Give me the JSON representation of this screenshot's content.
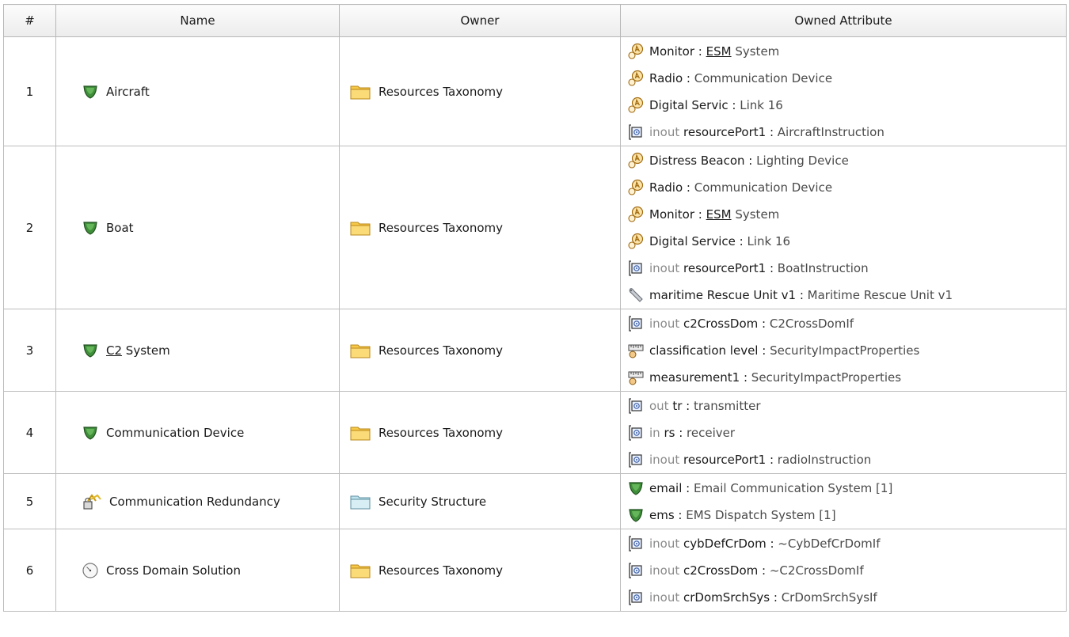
{
  "columns": {
    "num": "#",
    "name": "Name",
    "owner": "Owner",
    "owned_attribute": "Owned Attribute"
  },
  "rows": [
    {
      "num": "1",
      "name_parts": [
        {
          "t": "Aircraft"
        }
      ],
      "name_icon": "shield-block-icon",
      "owner": "Resources Taxonomy",
      "owner_icon": "package-folder-icon",
      "attrs": [
        {
          "icon": "resource-role-icon",
          "dir": "",
          "name": "Monitor",
          "type_ul": "ESM",
          "type": " System"
        },
        {
          "icon": "resource-role-icon",
          "dir": "",
          "name": "Radio",
          "type_ul": "",
          "type": "Communication Device"
        },
        {
          "icon": "resource-role-icon",
          "dir": "",
          "name": "Digital Servic",
          "type_ul": "",
          "type": "Link 16"
        },
        {
          "icon": "port-icon",
          "dir": "inout ",
          "name": "resourcePort1",
          "type_ul": "",
          "type": "AircraftInstruction"
        }
      ]
    },
    {
      "num": "2",
      "name_parts": [
        {
          "t": "Boat"
        }
      ],
      "name_icon": "shield-block-icon",
      "owner": "Resources Taxonomy",
      "owner_icon": "package-folder-icon",
      "attrs": [
        {
          "icon": "resource-role-icon",
          "dir": "",
          "name": "Distress Beacon",
          "type_ul": "",
          "type": "Lighting Device"
        },
        {
          "icon": "resource-role-icon",
          "dir": "",
          "name": "Radio",
          "type_ul": "",
          "type": "Communication Device"
        },
        {
          "icon": "resource-role-icon",
          "dir": "",
          "name": "Monitor",
          "type_ul": "ESM",
          "type": " System"
        },
        {
          "icon": "resource-role-icon",
          "dir": "",
          "name": "Digital Service",
          "type_ul": "",
          "type": "Link 16"
        },
        {
          "icon": "port-icon",
          "dir": "inout ",
          "name": "resourcePort1",
          "type_ul": "",
          "type": "BoatInstruction"
        },
        {
          "icon": "wrench-icon",
          "dir": "",
          "name": "maritime Rescue Unit v1",
          "type_ul": "",
          "type": "Maritime Rescue Unit v1"
        }
      ]
    },
    {
      "num": "3",
      "name_parts": [
        {
          "t": "C2",
          "ul": true
        },
        {
          "t": " System"
        }
      ],
      "name_icon": "shield-block-icon",
      "owner": "Resources Taxonomy",
      "owner_icon": "package-folder-icon",
      "attrs": [
        {
          "icon": "port-icon",
          "dir": "inout ",
          "name": "c2CrossDom",
          "type_ul": "",
          "type": "C2CrossDomIf"
        },
        {
          "icon": "measurement-icon",
          "dir": "",
          "name": "classification level",
          "type_ul": "",
          "type": "SecurityImpactProperties"
        },
        {
          "icon": "measurement-icon",
          "dir": "",
          "name": "measurement1",
          "type_ul": "",
          "type": "SecurityImpactProperties"
        }
      ]
    },
    {
      "num": "4",
      "name_parts": [
        {
          "t": "Communication Device"
        }
      ],
      "name_icon": "shield-block-icon",
      "owner": "Resources Taxonomy",
      "owner_icon": "package-folder-icon",
      "attrs": [
        {
          "icon": "port-icon",
          "dir": "out ",
          "name": "tr",
          "type_ul": "",
          "type": "transmitter"
        },
        {
          "icon": "port-icon",
          "dir": "in ",
          "name": "rs",
          "type_ul": "",
          "type": "receiver"
        },
        {
          "icon": "port-icon",
          "dir": "inout ",
          "name": "resourcePort1",
          "type_ul": "",
          "type": "radioInstruction"
        }
      ]
    },
    {
      "num": "5",
      "name_parts": [
        {
          "t": "Communication Redundancy"
        }
      ],
      "name_icon": "security-lock-icon",
      "owner": "Security Structure",
      "owner_icon": "security-package-icon",
      "attrs": [
        {
          "icon": "shield-block-icon",
          "dir": "",
          "name": "email",
          "type_ul": "",
          "type": "Email Communication System [1]"
        },
        {
          "icon": "shield-block-icon",
          "dir": "",
          "name": "ems",
          "type_ul": "",
          "type": "EMS Dispatch System [1]"
        }
      ]
    },
    {
      "num": "6",
      "name_parts": [
        {
          "t": "Cross Domain Solution"
        }
      ],
      "name_icon": "circle-dot-icon",
      "owner": "Resources Taxonomy",
      "owner_icon": "package-folder-icon",
      "attrs": [
        {
          "icon": "port-icon",
          "dir": "inout ",
          "name": "cybDefCrDom",
          "type_ul": "",
          "type": "~CybDefCrDomIf"
        },
        {
          "icon": "port-icon",
          "dir": "inout ",
          "name": "c2CrossDom",
          "type_ul": "",
          "type": "~C2CrossDomIf"
        },
        {
          "icon": "port-icon",
          "dir": "inout ",
          "name": "crDomSrchSys",
          "type_ul": "",
          "type": "CrDomSrchSysIf"
        }
      ]
    }
  ]
}
